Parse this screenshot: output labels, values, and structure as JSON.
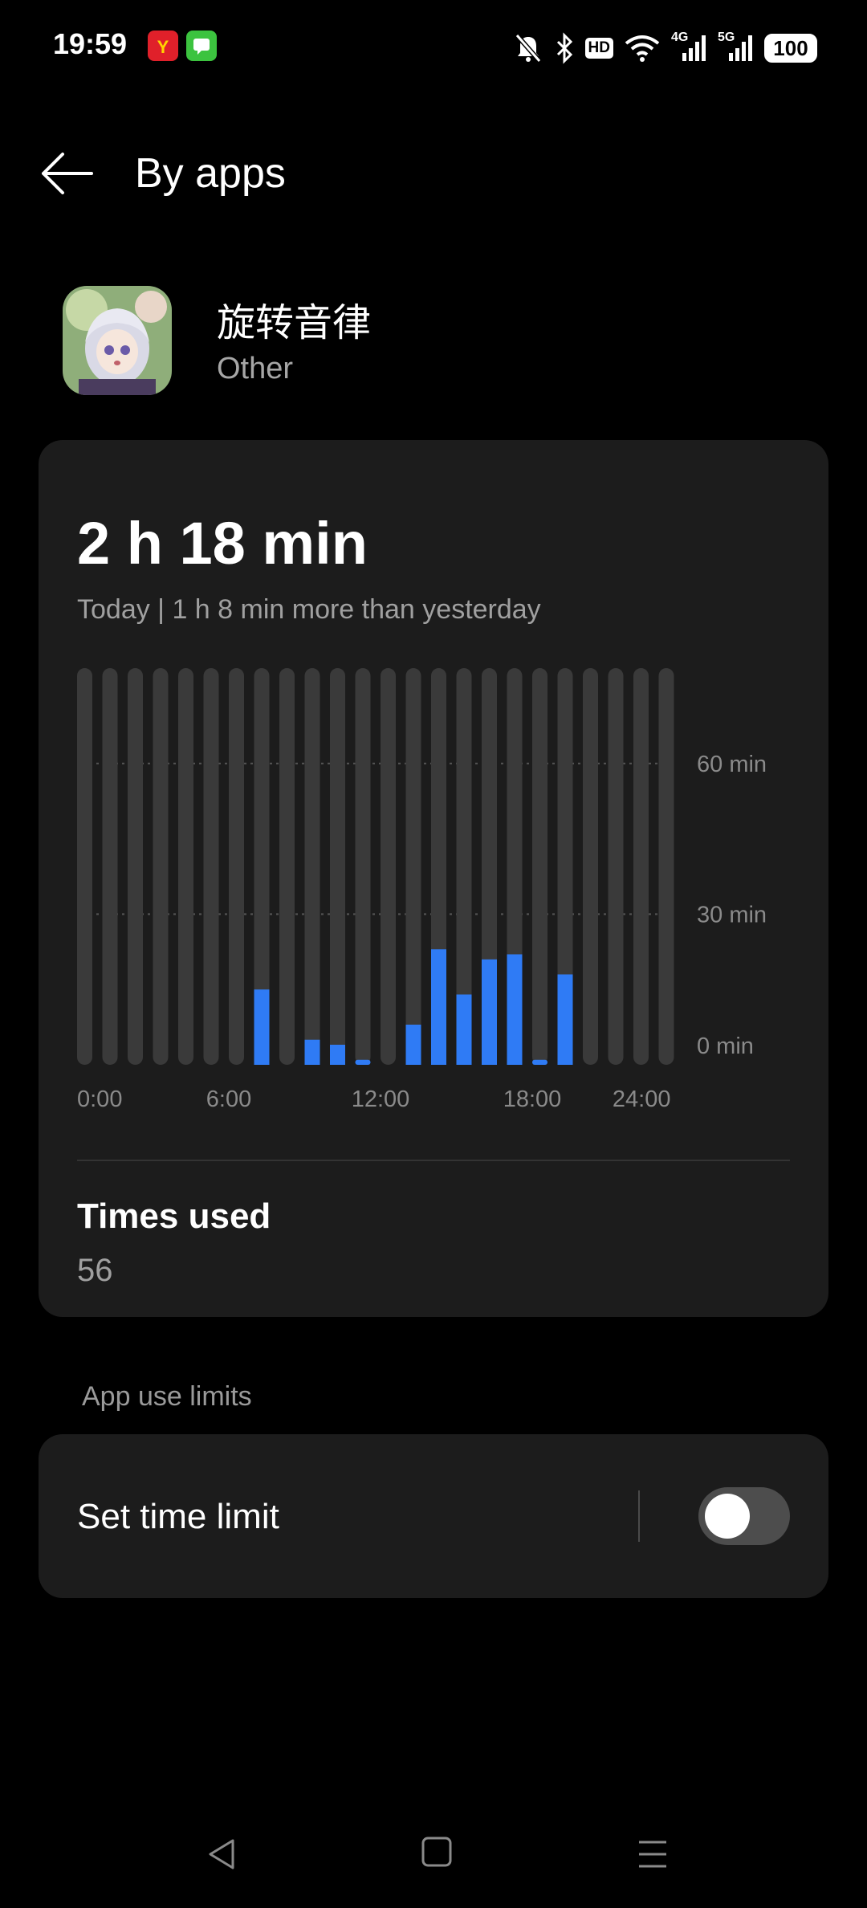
{
  "status_bar": {
    "time": "19:59",
    "battery": "100",
    "hd_label": "HD",
    "net_4g": "4G",
    "net_5g": "5G",
    "notif_icons": [
      "app-notification-icon-red",
      "message-icon-green"
    ],
    "right_icons": [
      "mute-bell-icon",
      "bluetooth-icon",
      "hd-voice-icon",
      "wifi-icon",
      "signal-4g-icon",
      "signal-5g-icon",
      "battery-icon"
    ]
  },
  "header": {
    "title": "By apps",
    "back_icon": "arrow-left-icon"
  },
  "app": {
    "name": "旋转音律",
    "category": "Other"
  },
  "usage": {
    "total": "2 h 18 min",
    "comparison": "Today | 1 h 8 min more than yesterday",
    "times_used_label": "Times used",
    "times_used_value": "56"
  },
  "chart_data": {
    "type": "bar",
    "x": [
      0,
      1,
      2,
      3,
      4,
      5,
      6,
      7,
      8,
      9,
      10,
      11,
      12,
      13,
      14,
      15,
      16,
      17,
      18,
      19,
      20,
      21,
      22,
      23
    ],
    "values": [
      0,
      0,
      0,
      0,
      0,
      0,
      0,
      15,
      0,
      5,
      4,
      1,
      0,
      8,
      23,
      14,
      21,
      22,
      1,
      18,
      0,
      0,
      0,
      0
    ],
    "x_tick_labels": [
      "0:00",
      "6:00",
      "12:00",
      "18:00",
      "24:00"
    ],
    "y_tick_labels": [
      "60 min",
      "30 min",
      "0 min"
    ],
    "y_ticks": [
      60,
      30,
      0
    ],
    "ylim": [
      0,
      79
    ],
    "grid": true,
    "colors": {
      "track": "#3a3a3a",
      "bar": "#2f7bf5",
      "grid": "#555555"
    }
  },
  "limits": {
    "section_label": "App use limits",
    "set_time_limit_label": "Set time limit",
    "toggle_on": false
  },
  "nav_bar": {
    "icons": [
      "nav-back-icon",
      "nav-home-icon",
      "nav-recents-icon"
    ]
  }
}
